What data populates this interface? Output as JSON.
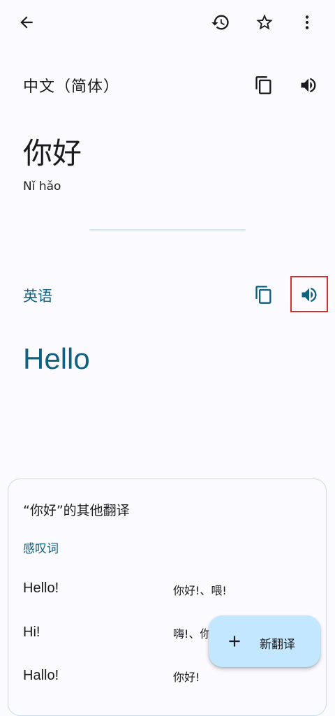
{
  "topbar": {
    "back_icon": "arrow-back-icon",
    "history_icon": "history-icon",
    "star_icon": "star-outline-icon",
    "more_icon": "more-vert-icon"
  },
  "source": {
    "language": "中文（简体）",
    "text": "你好",
    "transliteration": "Nǐ hǎo",
    "copy_icon": "copy-icon",
    "speak_icon": "volume-icon"
  },
  "target": {
    "language": "英语",
    "text": "Hello",
    "copy_icon": "copy-icon",
    "speak_icon": "volume-icon",
    "accent_color": "#0f6180"
  },
  "alternatives": {
    "title": "“你好”的其他翻译",
    "part_of_speech": "感叹词",
    "rows": [
      {
        "word": "Hello!",
        "back": "你好!、喂!"
      },
      {
        "word": "Hi!",
        "back": "嗨!、你好!"
      },
      {
        "word": "Hallo!",
        "back": "你好!"
      }
    ]
  },
  "fab": {
    "label": "新翻译",
    "icon": "plus-icon",
    "color": "#c3e7ff"
  },
  "highlight_color": "#d32f2f"
}
